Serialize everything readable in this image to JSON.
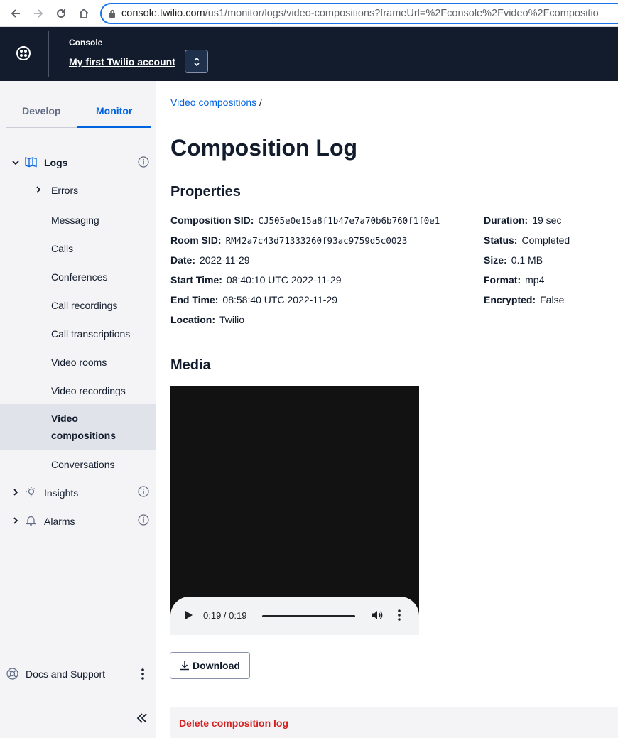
{
  "browser": {
    "url_host": "console.twilio.com",
    "url_path": "/us1/monitor/logs/video-compositions?frameUrl=%2Fconsole%2Fvideo%2Fcompositio"
  },
  "header": {
    "console_label": "Console",
    "account_name": "My first Twilio account"
  },
  "sidebar": {
    "tabs": [
      {
        "label": "Develop"
      },
      {
        "label": "Monitor"
      }
    ],
    "logs_label": "Logs",
    "items": [
      {
        "label": "Errors"
      },
      {
        "label": "Messaging"
      },
      {
        "label": "Calls"
      },
      {
        "label": "Conferences"
      },
      {
        "label": "Call recordings"
      },
      {
        "label": "Call transcriptions"
      },
      {
        "label": "Video rooms"
      },
      {
        "label": "Video recordings"
      },
      {
        "label": "Video compositions"
      },
      {
        "label": "Conversations"
      }
    ],
    "selected_line1": "Video",
    "selected_line2": "compositions",
    "insights_label": "Insights",
    "alarms_label": "Alarms",
    "docs_label": "Docs and Support"
  },
  "main": {
    "breadcrumb_link": "Video compositions",
    "breadcrumb_sep": "/",
    "title": "Composition Log",
    "properties_title": "Properties",
    "properties_left": [
      {
        "key": "Composition SID:",
        "value": "CJ505e0e15a8f1b47e7a70b6b760f1f0e1"
      },
      {
        "key": "Room SID:",
        "value": "RM42a7c43d71333260f93ac9759d5c0023"
      },
      {
        "key": "Date:",
        "value": "2022-11-29"
      },
      {
        "key": "Start Time:",
        "value": "08:40:10 UTC 2022-11-29"
      },
      {
        "key": "End Time:",
        "value": "08:58:40 UTC 2022-11-29"
      },
      {
        "key": "Location:",
        "value": "Twilio"
      }
    ],
    "properties_right": [
      {
        "key": "Duration:",
        "value": "19 sec"
      },
      {
        "key": "Status:",
        "value": "Completed"
      },
      {
        "key": "Size:",
        "value": "0.1 MB"
      },
      {
        "key": "Format:",
        "value": "mp4"
      },
      {
        "key": "Encrypted:",
        "value": "False"
      }
    ],
    "media_title": "Media",
    "player_time": "0:19 / 0:19",
    "download_label": "Download",
    "delete_label": "Delete composition log"
  }
}
